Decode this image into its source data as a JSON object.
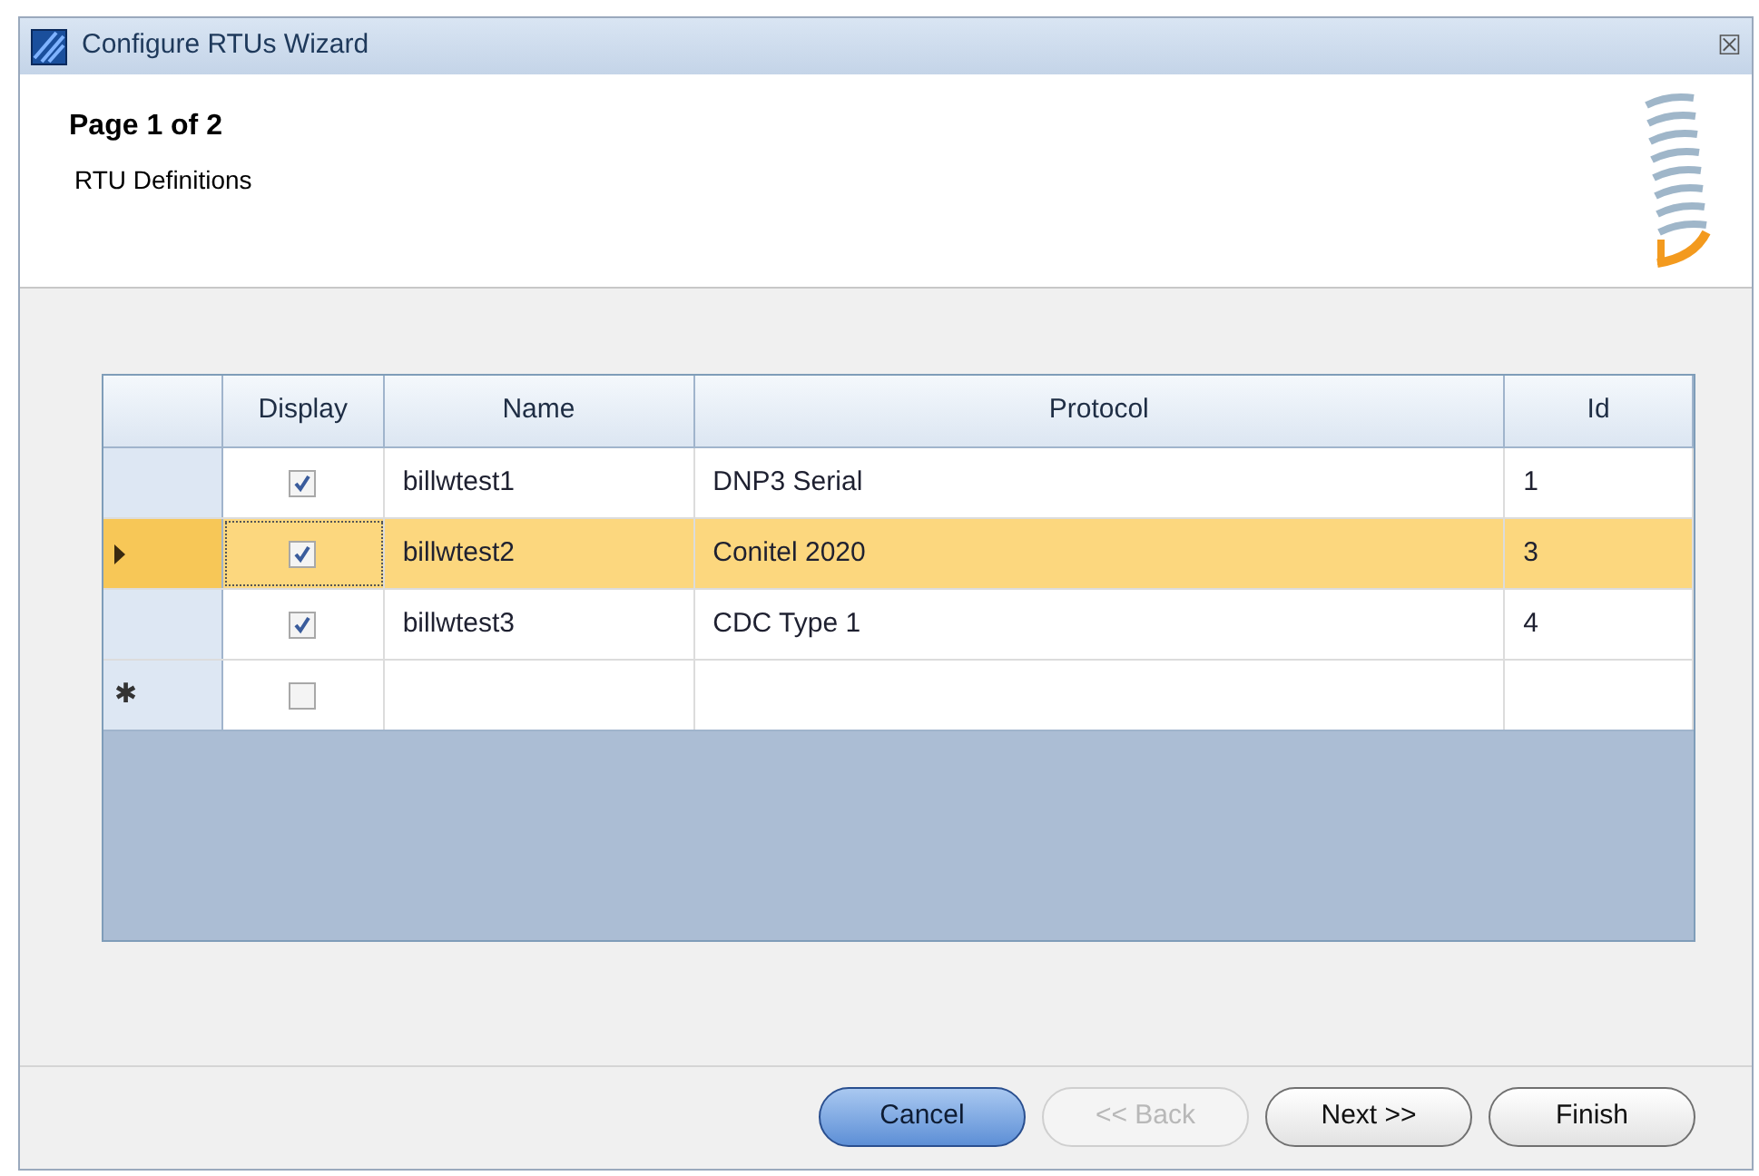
{
  "window": {
    "title": "Configure RTUs Wizard",
    "close_glyph": "☒"
  },
  "header": {
    "page": "Page 1 of 2",
    "subtitle": "RTU Definitions"
  },
  "table": {
    "columns": [
      "Display",
      "Name",
      "Protocol",
      "Id"
    ],
    "rows": [
      {
        "display_checked": true,
        "name": "billwtest1",
        "protocol": "DNP3 Serial",
        "id": "1",
        "selected": false
      },
      {
        "display_checked": true,
        "name": "billwtest2",
        "protocol": "Conitel 2020",
        "id": "3",
        "selected": true
      },
      {
        "display_checked": true,
        "name": "billwtest3",
        "protocol": "CDC Type 1",
        "id": "4",
        "selected": false
      }
    ],
    "new_row": {
      "marker": "✱",
      "display_checked": false
    }
  },
  "buttons": [
    {
      "label": "Cancel",
      "kind": "default",
      "disabled": false
    },
    {
      "label": "<< Back",
      "kind": "normal",
      "disabled": true
    },
    {
      "label": "Next >>",
      "kind": "normal",
      "disabled": false
    },
    {
      "label": "Finish",
      "kind": "normal",
      "disabled": false
    }
  ]
}
